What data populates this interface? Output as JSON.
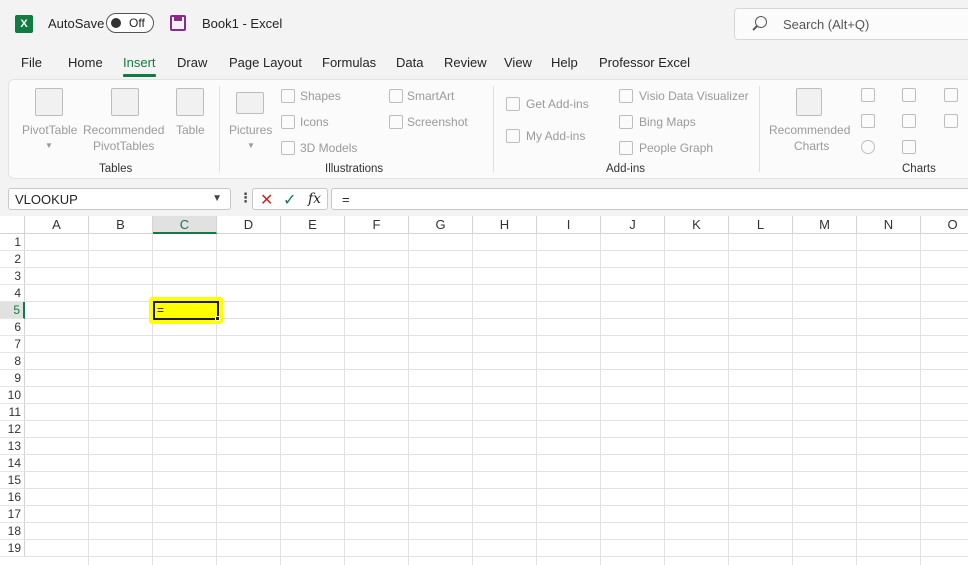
{
  "titlebar": {
    "autosave_label": "AutoSave",
    "autosave_state": "Off",
    "document_title": "Book1  -  Excel",
    "search_placeholder": "Search (Alt+Q)"
  },
  "tabs": [
    "File",
    "Home",
    "Insert",
    "Draw",
    "Page Layout",
    "Formulas",
    "Data",
    "Review",
    "View",
    "Help",
    "Professor Excel"
  ],
  "active_tab": "Insert",
  "ribbon": {
    "tables": {
      "group": "Tables",
      "pivottable": "PivotTable",
      "recommended_1": "Recommended",
      "recommended_2": "PivotTables",
      "table": "Table"
    },
    "illustrations": {
      "group": "Illustrations",
      "pictures": "Pictures",
      "shapes": "Shapes",
      "icons": "Icons",
      "models": "3D Models",
      "smartart": "SmartArt",
      "screenshot": "Screenshot"
    },
    "addins": {
      "group": "Add-ins",
      "get": "Get Add-ins",
      "my": "My Add-ins",
      "visio": "Visio Data Visualizer",
      "bing": "Bing Maps",
      "people": "People Graph"
    },
    "charts": {
      "group": "Charts",
      "rec_1": "Recommended",
      "rec_2": "Charts"
    }
  },
  "formula_bar": {
    "name_box": "VLOOKUP",
    "fx": "fx",
    "content": "="
  },
  "grid": {
    "columns": [
      "A",
      "B",
      "C",
      "D",
      "E",
      "F",
      "G",
      "H",
      "I",
      "J",
      "K",
      "L",
      "M",
      "N",
      "O"
    ],
    "rows": [
      "1",
      "2",
      "3",
      "4",
      "5",
      "6",
      "7",
      "8",
      "9",
      "10",
      "11",
      "12",
      "13",
      "14",
      "15",
      "16",
      "17",
      "18",
      "19"
    ],
    "active_cell": "C5",
    "active_cell_content": "="
  },
  "colors": {
    "accent": "#107c41",
    "highlight": "#ffff00"
  }
}
